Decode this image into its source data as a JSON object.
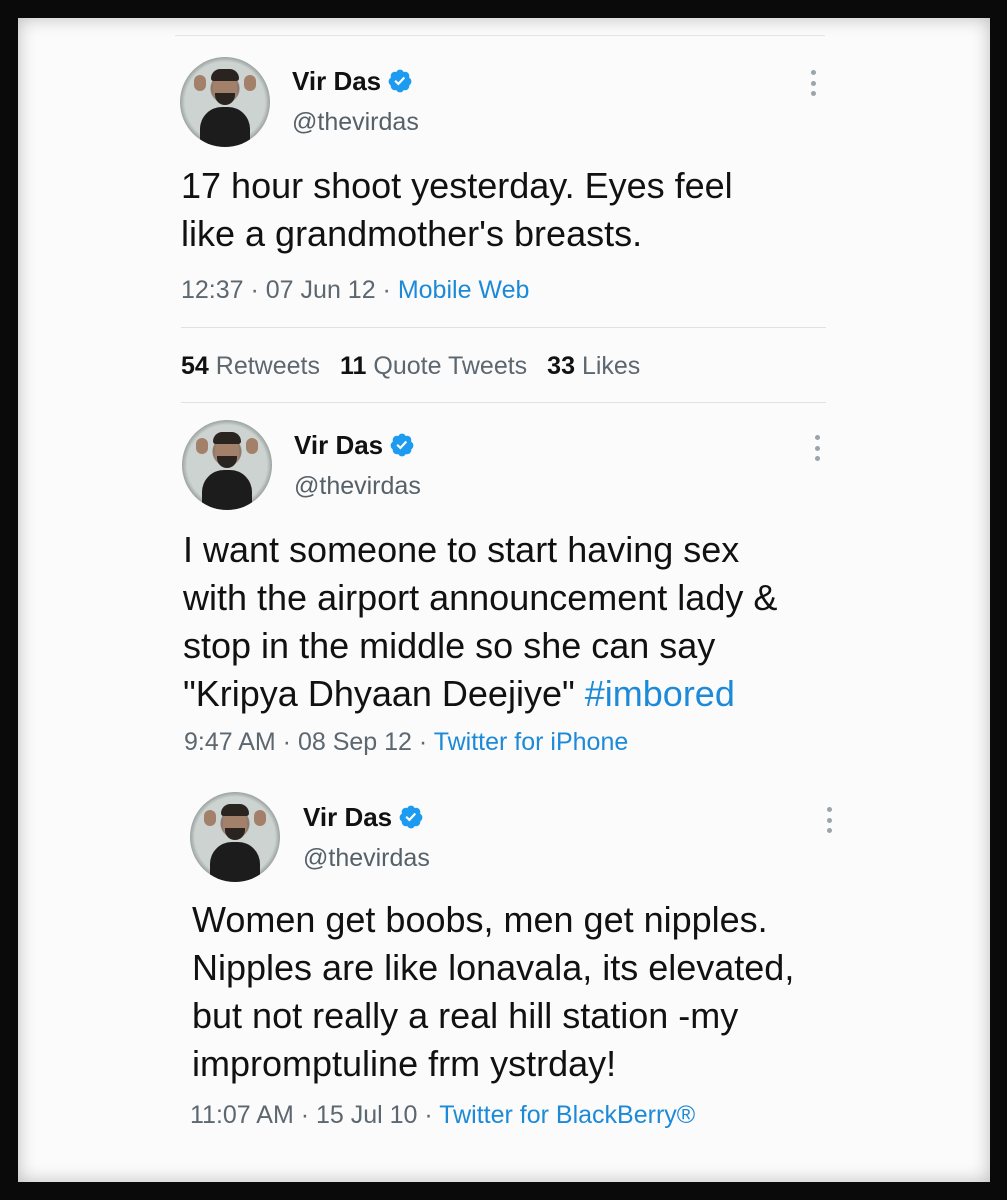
{
  "tweets": [
    {
      "name": "Vir Das",
      "handle": "@thevirdas",
      "text_lines": [
        "17 hour shoot yesterday. Eyes feel",
        "like a grandmother's breasts."
      ],
      "time": "12:37",
      "date": "07 Jun 12",
      "source": "Mobile Web"
    },
    {
      "name": "Vir Das",
      "handle": "@thevirdas",
      "text_lines": [
        "I want someone to start having sex",
        "with the airport announcement lady &",
        "stop in the middle so she can say",
        "\"Kripya Dhyaan Deejiye\""
      ],
      "hashtag": "#imbored",
      "time": "9:47 AM",
      "date": "08 Sep 12",
      "source": "Twitter for iPhone"
    },
    {
      "name": "Vir Das",
      "handle": "@thevirdas",
      "text_lines": [
        "Women get boobs, men get nipples.",
        "Nipples are like lonavala, its elevated,",
        "but not really a real hill station -my",
        "impromptuline frm ystrday!"
      ],
      "time": "11:07 AM",
      "date": "15 Jul 10",
      "source": "Twitter for BlackBerry®"
    }
  ],
  "stats": {
    "retweets_count": "54",
    "retweets_label": "Retweets",
    "quotes_count": "11",
    "quotes_label": "Quote Tweets",
    "likes_count": "33",
    "likes_label": "Likes"
  },
  "separator": " · ",
  "colors": {
    "link": "#1d8ad8",
    "verified": "#1d9bf0",
    "text": "#111111",
    "secondary": "#5d6770"
  }
}
